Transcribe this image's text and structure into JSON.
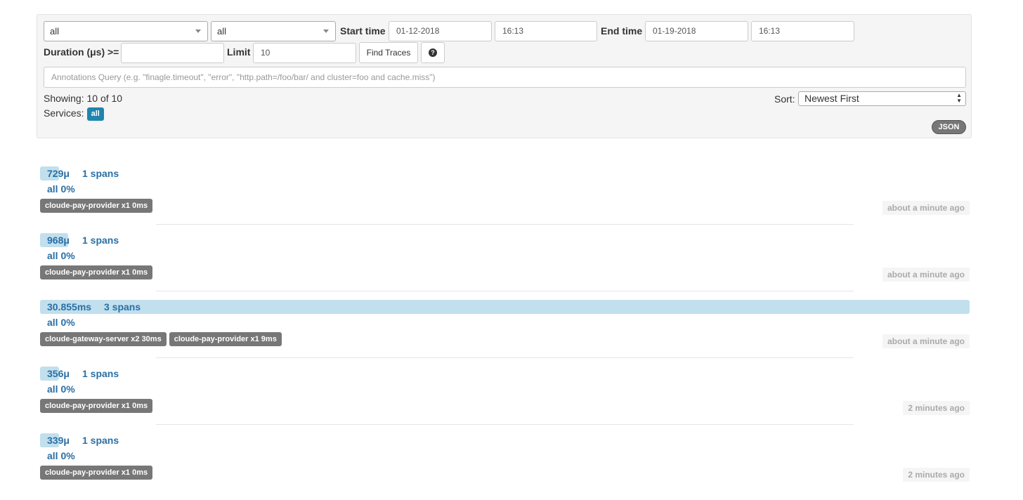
{
  "search": {
    "service_select": "all",
    "span_select": "all",
    "start_time_label": "Start time",
    "start_date": "01-12-2018",
    "start_clock": "16:13",
    "end_time_label": "End time",
    "end_date": "01-19-2018",
    "end_clock": "16:13",
    "duration_label": "Duration (μs) >=",
    "duration_value": "",
    "limit_label": "Limit",
    "limit_value": "10",
    "find_button": "Find Traces",
    "help_icon": "?",
    "annotations_placeholder": "Annotations Query (e.g. \"finagle.timeout\", \"error\", \"http.path=/foo/bar/ and cluster=foo and cache.miss\")"
  },
  "results": {
    "showing": "Showing: 10 of 10",
    "services_label": "Services:",
    "services_badge": "all",
    "sort_label": "Sort:",
    "sort_value": "Newest First",
    "json_button": "JSON"
  },
  "traces": [
    {
      "duration": "729μ",
      "spans": "1 spans",
      "all_pct": "all 0%",
      "bar_fraction": 0.02,
      "services": [
        "cloude-pay-provider x1 0ms"
      ],
      "ago": "about a minute ago"
    },
    {
      "duration": "968μ",
      "spans": "1 spans",
      "all_pct": "all 0%",
      "bar_fraction": 0.03,
      "services": [
        "cloude-pay-provider x1 0ms"
      ],
      "ago": "about a minute ago"
    },
    {
      "duration": "30.855ms",
      "spans": "3 spans",
      "all_pct": "all 0%",
      "bar_fraction": 1.0,
      "services": [
        "cloude-gateway-server x2 30ms",
        "cloude-pay-provider x1 9ms"
      ],
      "ago": "about a minute ago"
    },
    {
      "duration": "356μ",
      "spans": "1 spans",
      "all_pct": "all 0%",
      "bar_fraction": 0.012,
      "services": [
        "cloude-pay-provider x1 0ms"
      ],
      "ago": "2 minutes ago"
    },
    {
      "duration": "339μ",
      "spans": "1 spans",
      "all_pct": "all 0%",
      "bar_fraction": 0.011,
      "services": [
        "cloude-pay-provider x1 0ms"
      ],
      "ago": "2 minutes ago"
    }
  ],
  "colors": {
    "accent": "#2a6fa5",
    "bar": "#c1dfed",
    "badge": "#1f84ae",
    "chip": "#777777"
  }
}
